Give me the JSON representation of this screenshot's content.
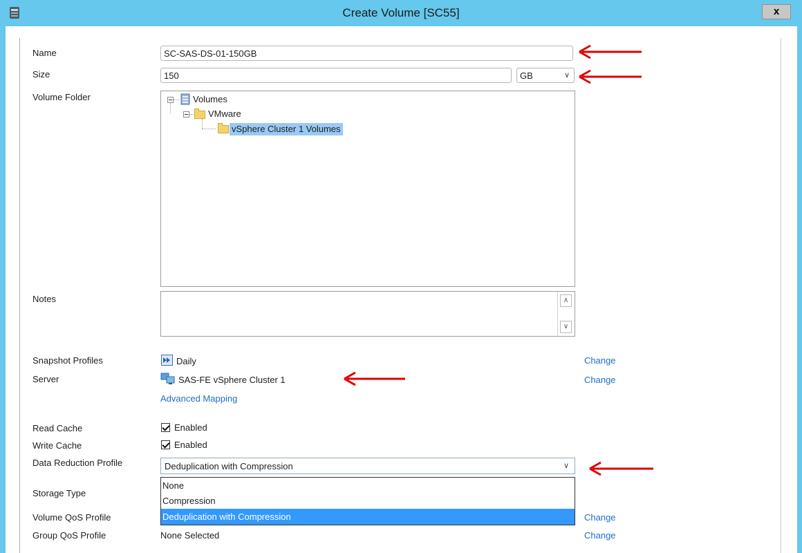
{
  "window": {
    "title": "Create Volume [SC55]",
    "close_label": "x"
  },
  "form": {
    "name_label": "Name",
    "name_value": "SC-SAS-DS-01-150GB",
    "size_label": "Size",
    "size_value": "150",
    "size_unit": "GB",
    "folder_label": "Volume Folder",
    "tree": [
      "Volumes",
      "VMware",
      "vSphere Cluster 1 Volumes"
    ],
    "notes_label": "Notes",
    "snapshot_label": "Snapshot Profiles",
    "snapshot_value": "Daily",
    "server_label": "Server",
    "server_value": "SAS-FE vSphere Cluster 1",
    "advanced_mapping": "Advanced Mapping",
    "change_label": "Change",
    "read_cache_label": "Read Cache",
    "write_cache_label": "Write Cache",
    "enabled_label": "Enabled",
    "data_reduction_label": "Data Reduction Profile",
    "data_reduction_value": "Deduplication with Compression",
    "data_reduction_options": [
      "None",
      "Compression",
      "Deduplication with Compression"
    ],
    "storage_type_label": "Storage Type",
    "volume_qos_label": "Volume QoS Profile",
    "group_qos_label": "Group QoS Profile",
    "group_qos_value": "None Selected"
  },
  "colors": {
    "titlebar": "#65c8ec",
    "selection": "#3399ff",
    "link": "#1f6fc5",
    "annotation_arrow": "#e00000"
  }
}
